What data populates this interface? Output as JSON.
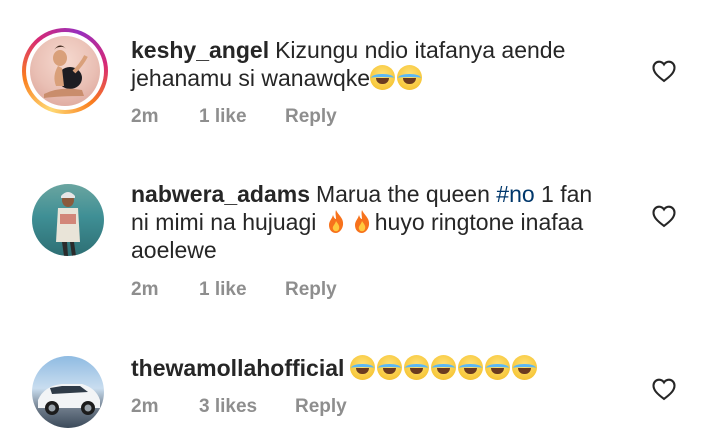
{
  "comments": [
    {
      "username": "keshy_angel",
      "text": "Kizungu ndio itafanya aende jehanamu si wanawqke",
      "emoji_count": 2,
      "time": "2m",
      "likes": "1 like",
      "reply": "Reply",
      "has_story_ring": true
    },
    {
      "username": "nabwera_adams",
      "text_before_hashtag": "Marua the queen ",
      "hashtag": "#no",
      "text_after_hashtag": " 1 fan ni mimi na hujuagi",
      "text_after_emoji": "huyo ringtone inafaa aoelewe",
      "time": "2m",
      "likes": "1 like",
      "reply": "Reply",
      "has_story_ring": false
    },
    {
      "username": "thewamollahofficial",
      "emoji_count": 7,
      "time": "2m",
      "likes": "3 likes",
      "reply": "Reply",
      "has_story_ring": false
    }
  ],
  "icons": {
    "like": "heart-outline-icon",
    "laugh": "face-with-tears-of-joy-emoji",
    "fire": "fire-emoji"
  },
  "colors": {
    "text": "#262626",
    "meta": "#8e8e8e",
    "hashtag": "#00376b"
  }
}
